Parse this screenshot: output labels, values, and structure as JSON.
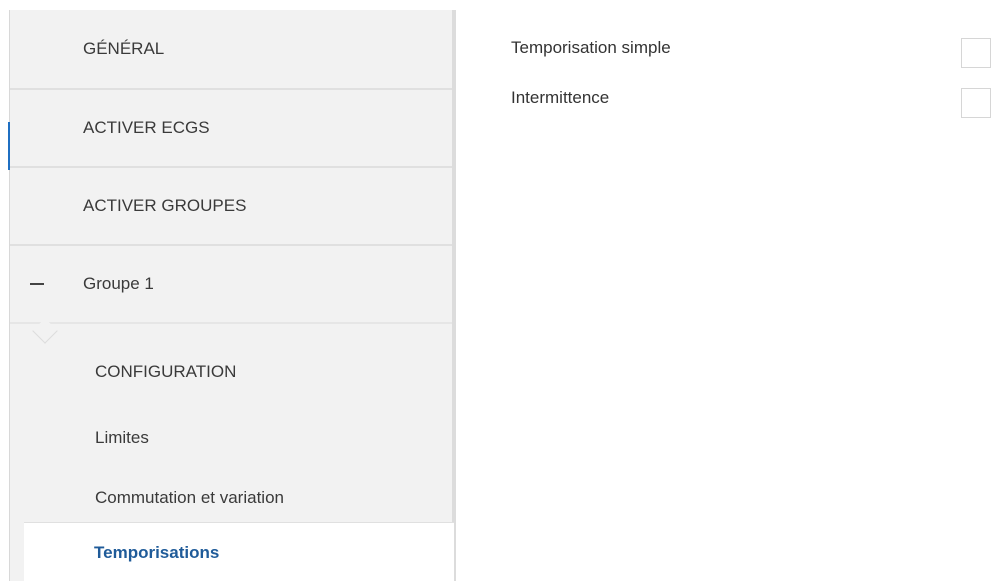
{
  "sidebar": {
    "items": [
      {
        "label": "GÉNÉRAL"
      },
      {
        "label": "ACTIVER ECGS"
      },
      {
        "label": "ACTIVER GROUPES"
      },
      {
        "label": "Groupe 1"
      }
    ],
    "sub_items": [
      {
        "label": "CONFIGURATION"
      },
      {
        "label": "Limites"
      },
      {
        "label": "Commutation et variation"
      }
    ],
    "active_item": {
      "label": "Temporisations"
    }
  },
  "content": {
    "options": [
      {
        "label": "Temporisation simple",
        "checked": false
      },
      {
        "label": "Intermittence",
        "checked": false
      }
    ]
  },
  "colors": {
    "accent": "#1f6fc2",
    "active_text": "#1f5b99",
    "sidebar_bg": "#f2f2f2"
  }
}
